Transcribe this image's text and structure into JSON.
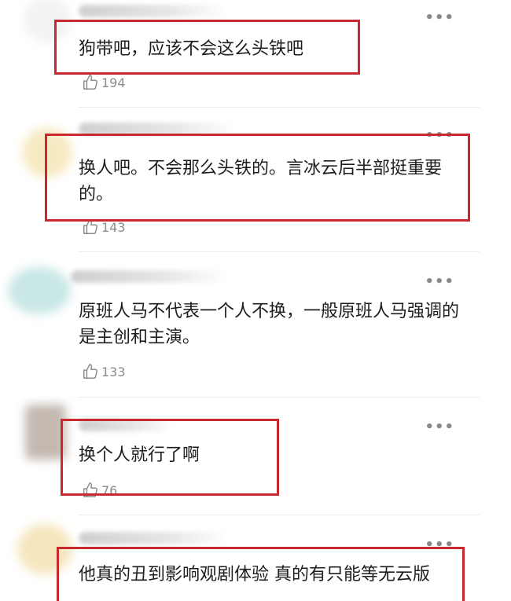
{
  "more_glyph": "•••",
  "comments": [
    {
      "text": "狗带吧，应该不会这么头铁吧",
      "likes": "194",
      "avatar_color": "#f3f3f3"
    },
    {
      "text": "换人吧。不会那么头铁的。言冰云后半部挺重要的。",
      "likes": "143",
      "avatar_color": "#f6e7b9"
    },
    {
      "text": "原班人马不代表一个人不换，一般原班人马强调的是主创和主演。",
      "likes": "133",
      "avatar_color": "#bfe3e1"
    },
    {
      "text": "换个人就行了啊",
      "likes": "76",
      "avatar_color": "#b9ada3"
    },
    {
      "text": "他真的丑到影响观剧体验 真的有只能等无云版",
      "likes": "",
      "avatar_color": "#f4e2b3"
    }
  ],
  "highlight_color": "#c9282d"
}
